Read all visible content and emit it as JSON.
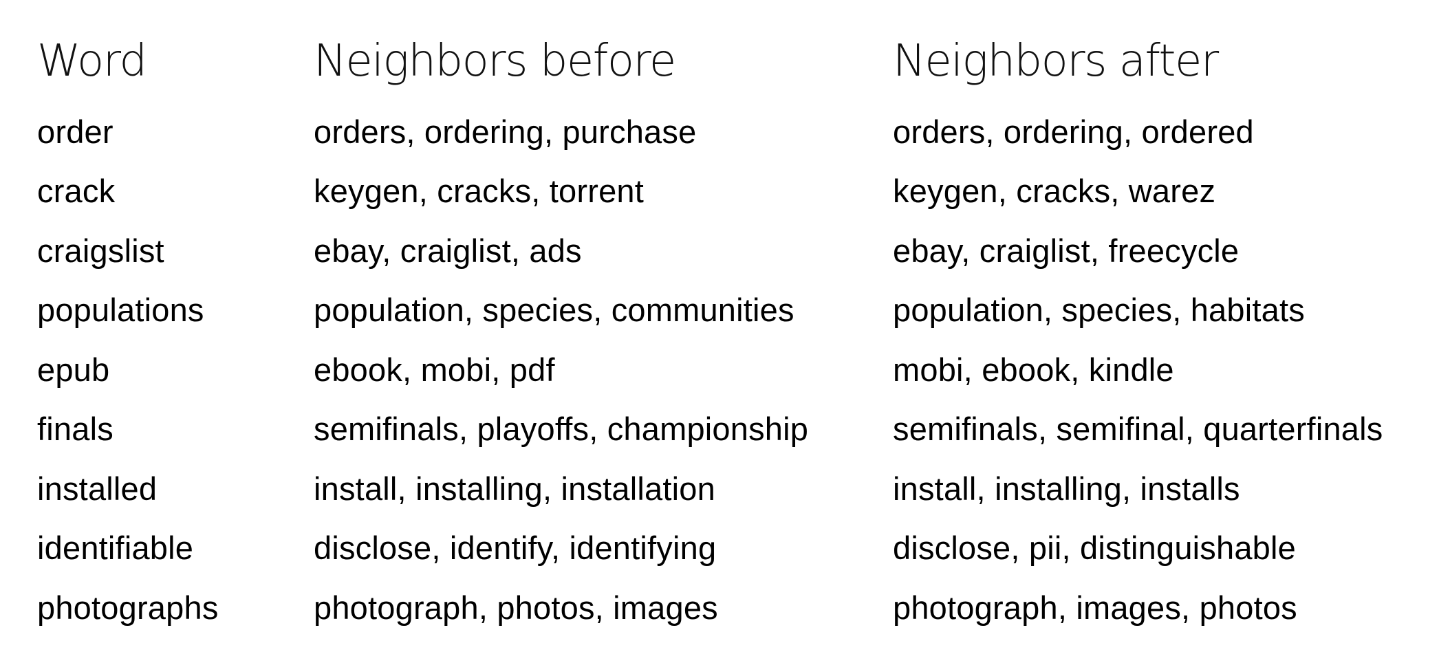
{
  "headers": {
    "word": "Word",
    "before": "Neighbors before",
    "after": "Neighbors after"
  },
  "rows": [
    {
      "word": "order",
      "before": "orders, ordering, purchase",
      "after": "orders, ordering, ordered"
    },
    {
      "word": "crack",
      "before": "keygen, cracks, torrent",
      "after": "keygen, cracks, warez"
    },
    {
      "word": "craigslist",
      "before": "ebay, craiglist, ads",
      "after": "ebay, craiglist, freecycle"
    },
    {
      "word": "populations",
      "before": "population, species, communities",
      "after": "population, species, habitats"
    },
    {
      "word": "epub",
      "before": "ebook, mobi, pdf",
      "after": "mobi, ebook, kindle"
    },
    {
      "word": "finals",
      "before": "semifinals, playoffs, championship",
      "after": "semifinals, semifinal, quarterfinals"
    },
    {
      "word": "installed",
      "before": "install, installing, installation",
      "after": "install, installing, installs"
    },
    {
      "word": "identifiable",
      "before": "disclose, identify, identifying",
      "after": "disclose, pii, distinguishable"
    },
    {
      "word": "photographs",
      "before": "photograph, photos, images",
      "after": "photograph, images, photos"
    }
  ]
}
